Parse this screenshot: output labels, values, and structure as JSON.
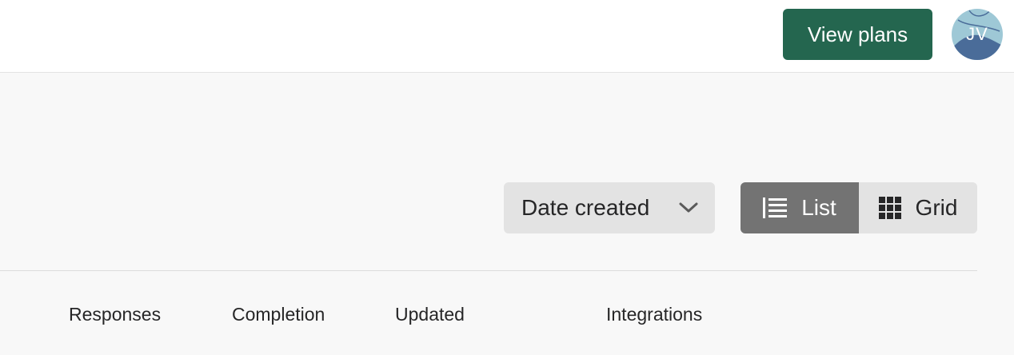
{
  "header": {
    "view_plans_label": "View plans",
    "avatar": {
      "initials": "JV"
    }
  },
  "toolbar": {
    "sort": {
      "selected": "Date created",
      "icon": "chevron-down-icon"
    },
    "view_toggle": {
      "list_label": "List",
      "list_icon": "list-icon",
      "grid_label": "Grid",
      "grid_icon": "grid-icon",
      "active": "List"
    }
  },
  "table": {
    "columns": [
      "Responses",
      "Completion",
      "Updated",
      "Integrations"
    ]
  },
  "colors": {
    "primary_button": "#24664f",
    "active_toggle": "#737373",
    "control_bg": "#e3e3e3",
    "page_bg": "#f8f8f8"
  }
}
